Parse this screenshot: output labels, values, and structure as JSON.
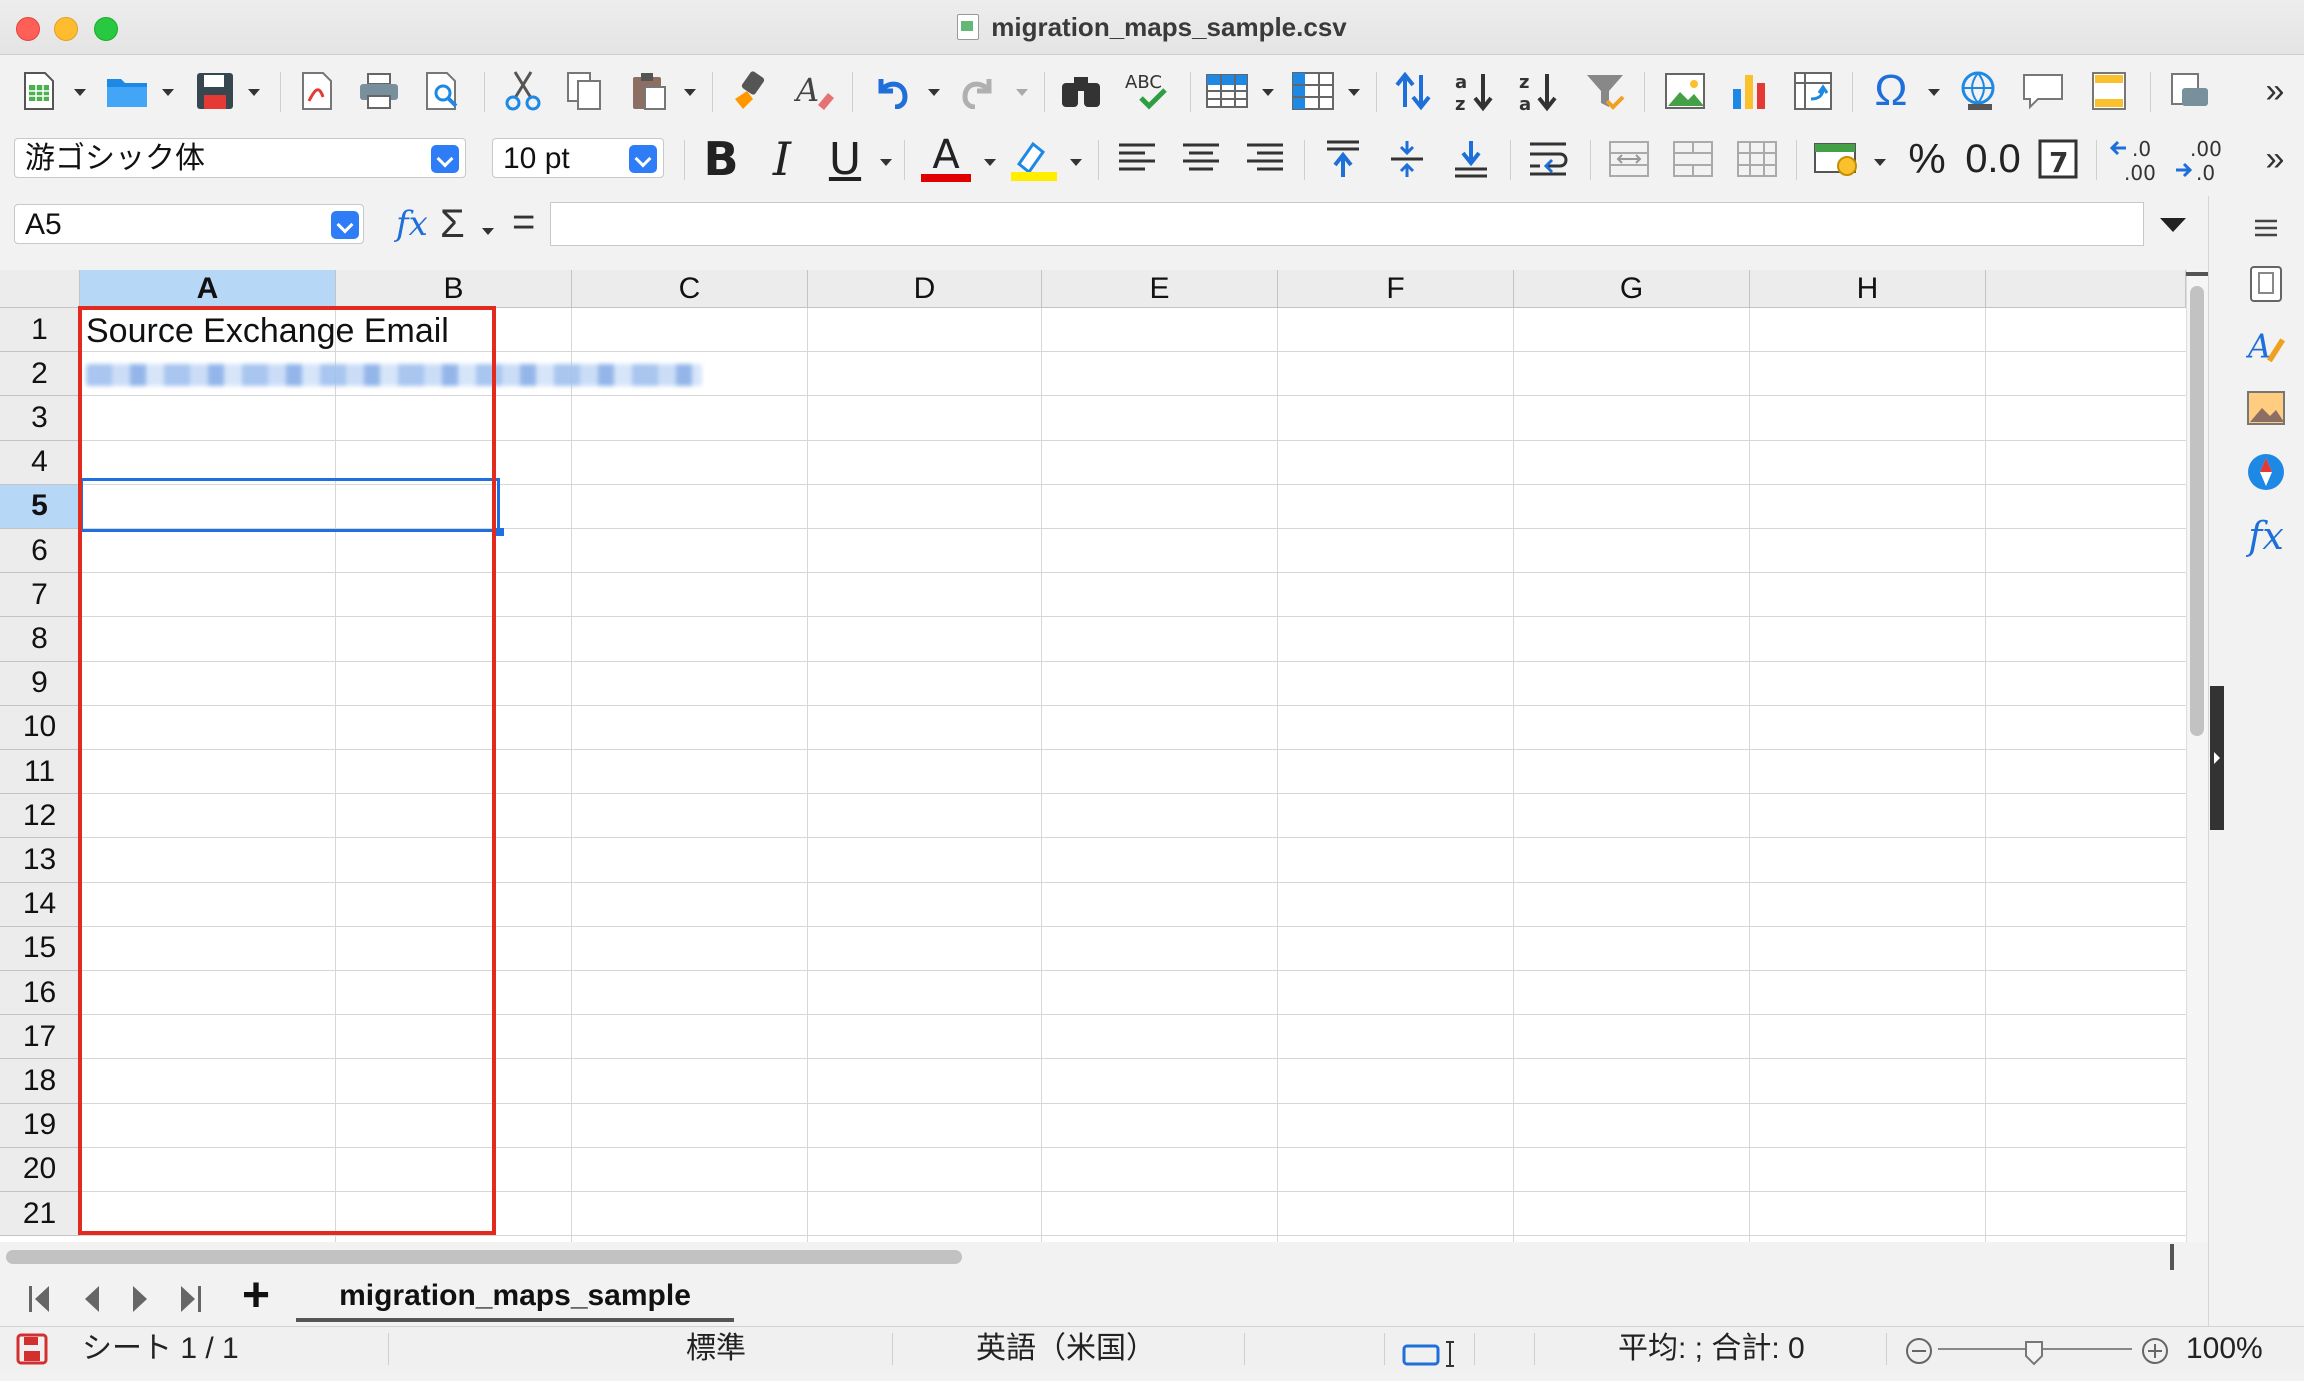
{
  "window": {
    "title": "migration_maps_sample.csv"
  },
  "toolbar2": {
    "font_name": "游ゴシック体",
    "font_size": "10 pt",
    "bold": "B",
    "italic": "I",
    "underline": "U",
    "font_color_letter": "A",
    "percent": "%",
    "number_format": "0.0",
    "add_decimal": ".0\n.00",
    "del_decimal": ".00\n.0"
  },
  "formula_bar": {
    "name_box": "A5",
    "fx": "fx",
    "sum": "Σ",
    "equals": "=",
    "content": ""
  },
  "grid": {
    "columns": [
      "A",
      "B",
      "C",
      "D",
      "E",
      "F",
      "G",
      "H"
    ],
    "rows": [
      "1",
      "2",
      "3",
      "4",
      "5",
      "6",
      "7",
      "8",
      "9",
      "10",
      "11",
      "12",
      "13",
      "14",
      "15",
      "16",
      "17",
      "18",
      "19",
      "20",
      "21"
    ],
    "selected_column": "A",
    "selected_row": "5",
    "cells": {
      "A1": "Source Exchange Email"
    }
  },
  "sheet_tabs": {
    "add": "+",
    "tabs": [
      "migration_maps_sample"
    ]
  },
  "status_bar": {
    "sheet": "シート 1 / 1",
    "style": "標準",
    "language": "英語（米国）",
    "summary": "平均: ; 合計: 0",
    "zoom": "100%"
  },
  "colors": {
    "selection": "#1f6fe0",
    "highlight_outline": "#e32a1e",
    "header_selected": "#b7d7f7"
  }
}
